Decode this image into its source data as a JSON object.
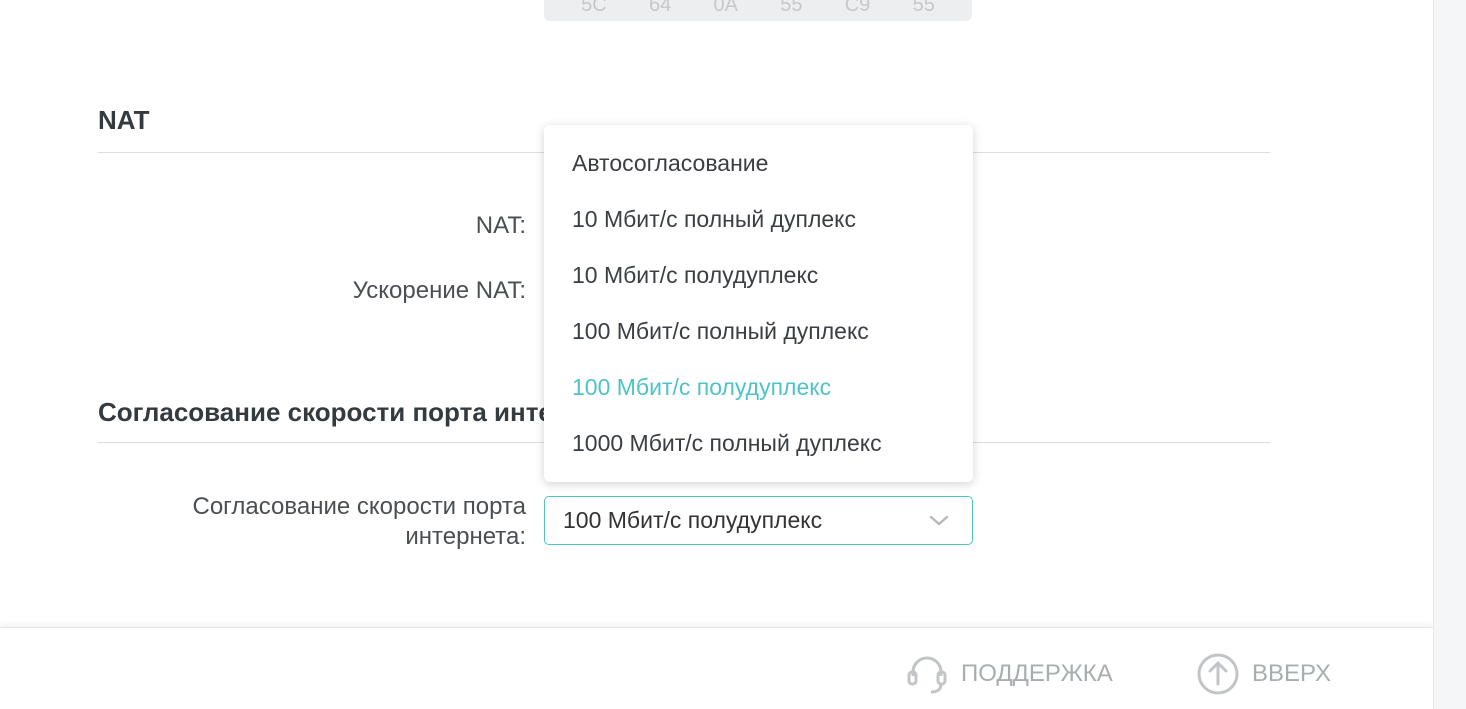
{
  "mac_row": {
    "bytes": [
      "5C",
      "64",
      "0A",
      "55",
      "C9",
      "55"
    ]
  },
  "nat_section": {
    "title": "NAT",
    "nat_label": "NAT:",
    "nat_accel_label": "Ускорение NAT:"
  },
  "speed_section": {
    "title": "Согласование скорости порта интернета",
    "field_label_line1": "Согласование скорости порта",
    "field_label_line2": "интернета:",
    "selected_value": "100 Мбит/с полудуплекс",
    "options": [
      "Автосогласование",
      "10 Мбит/с полный дуплекс",
      "10 Мбит/с полудуплекс",
      "100 Мбит/с полный дуплекс",
      "100 Мбит/с полудуплекс",
      "1000 Мбит/с полный дуплекс"
    ]
  },
  "footer": {
    "support_label": "ПОДДЕРЖКА",
    "top_label": "ВВЕРХ"
  },
  "colors": {
    "accent": "#4fc3c7",
    "muted": "#a9adb0"
  }
}
